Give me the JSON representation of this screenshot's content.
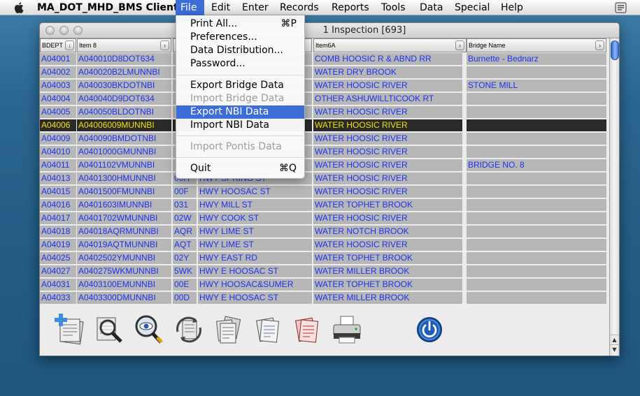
{
  "menubar": {
    "app_name": "MA_DOT_MHD_BMS Client",
    "items": [
      "File",
      "Edit",
      "Enter",
      "Records",
      "Reports",
      "Tools",
      "Data",
      "Special",
      "Help"
    ],
    "active_item": "File",
    "active_color": "#3d6ed7"
  },
  "window": {
    "title_visible": "1 Inspection [693]"
  },
  "table": {
    "headers": [
      "BDEPT",
      "Item 8",
      "",
      "",
      "Item6A",
      "Bridge Name"
    ],
    "rows": [
      [
        "A04001",
        "A040010D8DOT634",
        "",
        "",
        "COMB  HOOSIC R & ABND RR",
        "Burnette - Bednarz"
      ],
      [
        "A04002",
        "A040020B2LMUNNBI",
        "",
        "",
        "WATER DRY BROOK",
        ""
      ],
      [
        "A04003",
        "A040030BKDOTNBI",
        "",
        "",
        "WATER HOOSIC RIVER",
        "STONE MILL"
      ],
      [
        "A04004",
        "A040040D9DOT634",
        "",
        "",
        "OTHER ASHUWILLTICOOK RT",
        ""
      ],
      [
        "A04005",
        "A040050BLDOTNBI",
        "",
        "",
        "WATER HOOSIC RIVER",
        ""
      ],
      [
        "A04006",
        "A04006009MUNNBI",
        "",
        "",
        "WATER HOOSIC RIVER",
        ""
      ],
      [
        "A04009",
        "A040090BMDOTNBI",
        "",
        "",
        "WATER HOOSIC RIVER",
        ""
      ],
      [
        "A04010",
        "A0401000GMUNNBI",
        "",
        "",
        "WATER HOOSIC RIVER",
        ""
      ],
      [
        "A04011",
        "A0401102VMUNNBI",
        "",
        "",
        "WATER HOOSIC RIVER",
        "BRIDGE NO. 8"
      ],
      [
        "A04013",
        "A0401300HMUNNBI",
        "00H",
        "HWY   SPRING ST",
        "WATER HOOSIC RIVER",
        ""
      ],
      [
        "A04015",
        "A0401500FMUNNBI",
        "00F",
        "HWY   HOOSAC ST",
        "WATER HOOSIC RIVER",
        ""
      ],
      [
        "A04016",
        "A0401603IMUNNBI",
        "031",
        "HWY   MILL ST",
        "WATER TOPHET BROOK",
        ""
      ],
      [
        "A04017",
        "A0401702WMUNNBI",
        "02W",
        "HWY   COOK ST",
        "WATER HOOSIC RIVER",
        ""
      ],
      [
        "A04018",
        "A04018AQRMUNNBI",
        "AQR",
        "HWY   LIME ST",
        "WATER NOTCH BROOK",
        ""
      ],
      [
        "A04019",
        "A04019AQTMUNNBI",
        "AQT",
        "HWY   LIME ST",
        "WATER HOOSIC RIVER",
        ""
      ],
      [
        "A04025",
        "A0402502YMUNNBI",
        "02Y",
        "HWY   EAST RD",
        "WATER TOPHET BROOK",
        ""
      ],
      [
        "A04027",
        "A040275WKMUNNBI",
        "5WK",
        "HWY   E HOOSAC ST",
        "WATER MILLER BROOK",
        ""
      ],
      [
        "A04031",
        "A0403100EMUNNBI",
        "00E",
        "HWY   HOOSAC&SUMER",
        "WATER TOPHET BROOK",
        ""
      ],
      [
        "A04033",
        "A0403300DMUNNBI",
        "00D",
        "HWY   E HOOSAC ST",
        "WATER MILLER BROOK",
        ""
      ]
    ],
    "selected_row": 5,
    "cell_text_color": "#1d33ee",
    "selected_text_color": "#f2e200"
  },
  "file_menu": {
    "items": [
      {
        "label": "Print All...",
        "shortcut": "⌘P",
        "enabled": true
      },
      {
        "label": "Preferences...",
        "shortcut": "",
        "enabled": true
      },
      {
        "label": "Data Distribution...",
        "shortcut": "",
        "enabled": true
      },
      {
        "label": "Password...",
        "shortcut": "",
        "enabled": true
      },
      {
        "label": "Export Bridge Data",
        "shortcut": "",
        "enabled": true
      },
      {
        "label": "Import Bridge Data",
        "shortcut": "",
        "enabled": false
      },
      {
        "label": "Export NBI Data",
        "shortcut": "",
        "enabled": true,
        "highlighted": true
      },
      {
        "label": "Import NBI Data",
        "shortcut": "",
        "enabled": true
      },
      {
        "label": "Import Pontis Data",
        "shortcut": "",
        "enabled": false
      },
      {
        "label": "Quit",
        "shortcut": "⌘Q",
        "enabled": true
      }
    ]
  },
  "toolbar": {
    "icons": [
      "add-record-icon",
      "find-icon",
      "view-icon",
      "refresh-icon",
      "documents-icon",
      "report-icon",
      "report-red-icon",
      "print-icon",
      "power-icon"
    ]
  }
}
